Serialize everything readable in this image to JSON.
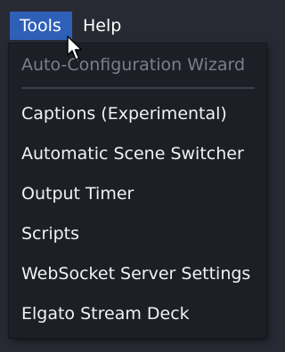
{
  "menubar": {
    "items": [
      {
        "label": "Tools",
        "active": true
      },
      {
        "label": "Help",
        "active": false
      }
    ]
  },
  "tools_menu": {
    "items": [
      {
        "label": "Auto-Configuration Wizard",
        "enabled": false
      },
      {
        "label": "Captions (Experimental)",
        "enabled": true
      },
      {
        "label": "Automatic Scene Switcher",
        "enabled": true
      },
      {
        "label": "Output Timer",
        "enabled": true
      },
      {
        "label": "Scripts",
        "enabled": true
      },
      {
        "label": "WebSocket Server Settings",
        "enabled": true
      },
      {
        "label": "Elgato Stream Deck",
        "enabled": true
      }
    ]
  },
  "colors": {
    "background": "#272a33",
    "menu_background": "#1c1f26",
    "active_highlight": "#2f60b8",
    "disabled_text": "#7c7f87",
    "text": "#f2f2f2"
  },
  "cursor": {
    "icon": "arrow-pointer-icon"
  }
}
